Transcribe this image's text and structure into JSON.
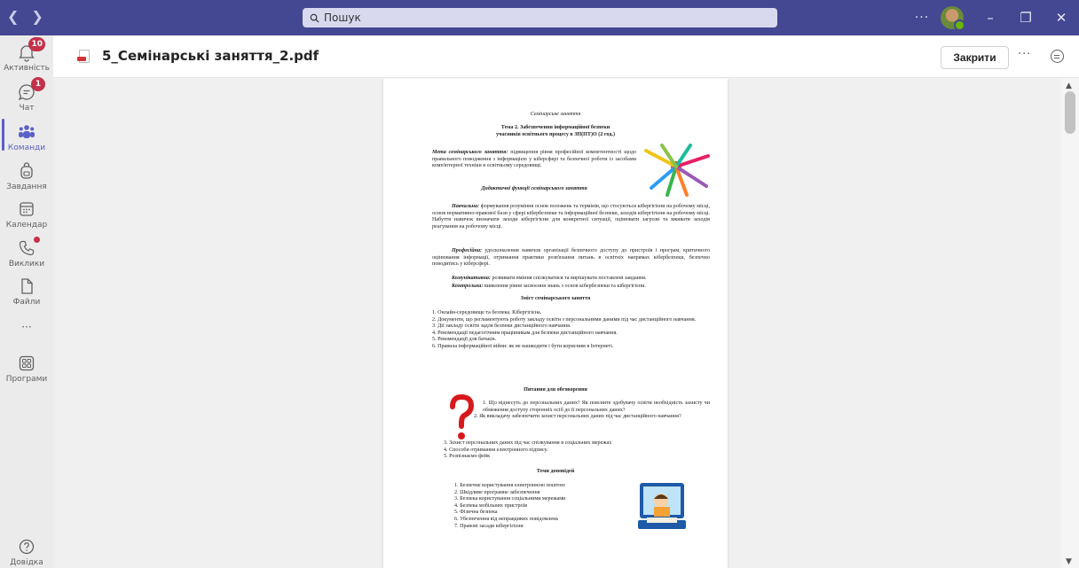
{
  "titlebar": {
    "back_icon": "chevron-left-icon",
    "forward_icon": "chevron-right-icon",
    "search_placeholder": "Пошук",
    "more_label": "···",
    "minimize_label": "–",
    "maximize_label": "❐",
    "close_label": "✕"
  },
  "rail": {
    "items": [
      {
        "label": "Активність",
        "badge": "10"
      },
      {
        "label": "Чат",
        "badge": "1"
      },
      {
        "label": "Команди"
      },
      {
        "label": "Завдання"
      },
      {
        "label": "Календар"
      },
      {
        "label": "Виклики"
      },
      {
        "label": "Файли"
      },
      {
        "label": "···"
      },
      {
        "label": "Програми"
      },
      {
        "label": "Довідка"
      }
    ]
  },
  "header": {
    "filename": "5_Семінарські заняття_2.pdf",
    "close_label": "Закрити",
    "more_label": "···"
  },
  "document": {
    "kicker": "Семінарське заняття",
    "title_line1": "Тема 2. Забезпечення інформаційної безпеки",
    "title_line2": "учасників освітнього процесу в ЗП(ПТ)О (2 год.)",
    "goal_label": "Мета семінарського заняття:",
    "goal_text": " підвищення рівня професійної компетентності щодо правильного поводження з інформацією у кіберсфері та безпечної роботи із засобами комп'ютерної техніки в освітньому середовищі.",
    "functions_heading": "Дидактичні функції семінарського заняття",
    "f1_label": "Навчальна:",
    "f1_text": " формування розуміння основ положень та термінів, що стосуються кібергігієни на робочому місці, основ нормативно-правової бази у сфері кібербезпеки та інформаційної безпеки, заходів кібергігієни на робочому місці. Набуття навичок визначати заходи кібергігієни для конкретної ситуації, оцінювати загрози та вживати заходів реагування на робочому місці.",
    "f2_label": "Професійна:",
    "f2_text": " удосконалення навичок організації безпечного доступу до пристроїв і програм, критичного оцінювання інформації, отримання практики розв'язання питань в освітніх напрямах кібербезпеки, безпечно поводитись у кіберсфері.",
    "f3_label": "Комунікативна:",
    "f3_text": " розвивати вміння спілкуватися та вирішувати поставлені завдання.",
    "f4_label": "Контрольна:",
    "f4_text": " виявлення рівня засвоєння знань з основ кібербезпеки та кібергігієни.",
    "content_heading": "Зміст семінарського заняття",
    "content_items": [
      "1. Онлайн-середовище та безпека. Кібергігієна.",
      "2. Документи, що регламентують роботу закладу освіти з персональними даними під час дистанційного навчання.",
      "3. Дії закладу освіти задля безпеки дистанційного навчання.",
      "4. Рекомендації педагогічним працівникам для безпеки дистанційного навчання.",
      "5. Рекомендації для батьків.",
      "6. Правила інформаційної війни: як не нашкодити і бути корисним в Інтернеті."
    ],
    "questions_heading": "Питання для обговорення",
    "questions": [
      "1.        Що віднесуть до персональних даних? Як поясните здобувачу освіти необхідність захисту чи обмеження доступу сторонніх осіб до її персональних даних?",
      "2.   Як викладачу забезпечити захист персональних даних під час дистанційного навчання?",
      "3.   Захист персональних даних під час спілкування в соціальних мережах",
      "4.   Способи отримання електронного підпису.",
      "5.   Розпізнаємо фейк"
    ],
    "reports_heading": "Теми доповідей",
    "reports": [
      "1.  Безпечне користування електронною поштою",
      "2.  Шкідливе програмне забезпечення",
      "3.  Безпека користування соціальними мережами",
      "4.  Безпека мобільних пристроїв",
      "5.  Фізична безпека",
      "6.  Убезпечення від неправдивих повідомлень",
      "7.  Правові засади кібергігієни"
    ]
  },
  "colors": {
    "titlebar": "#444791",
    "accent": "#5b5fc7",
    "badge": "#c4314b"
  }
}
